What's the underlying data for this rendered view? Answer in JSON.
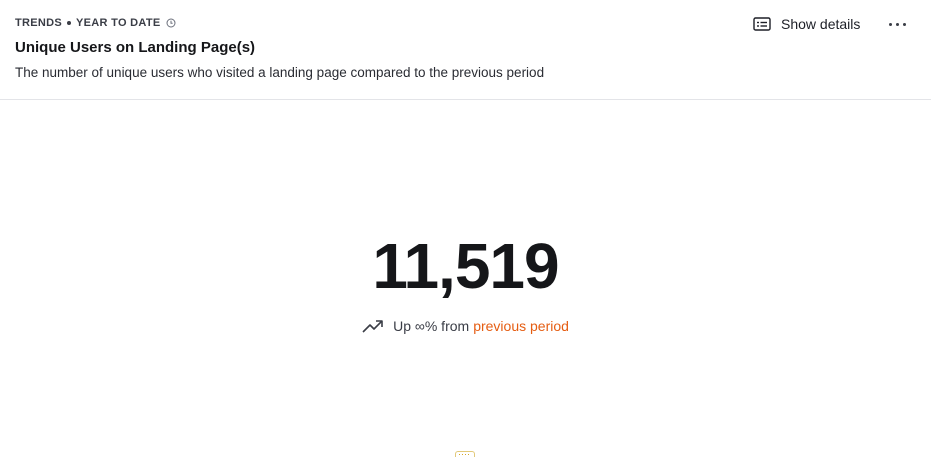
{
  "header": {
    "insight_type": "TRENDS",
    "date_range": "YEAR TO DATE",
    "title": "Unique Users on Landing Page(s)",
    "description": "The number of unique users who visited a landing page compared to the previous period",
    "show_details_label": "Show details",
    "icons": {
      "clock": "clock-icon",
      "details": "details-icon",
      "more": "more-icon"
    }
  },
  "metric": {
    "value": "11,519",
    "trend_prefix": "Up ∞% from",
    "trend_link": "previous period",
    "trend_icon": "trending-up-icon"
  },
  "colors": {
    "accent_link": "#e55d12",
    "text": "#151619",
    "divider": "#e3e4e8"
  }
}
